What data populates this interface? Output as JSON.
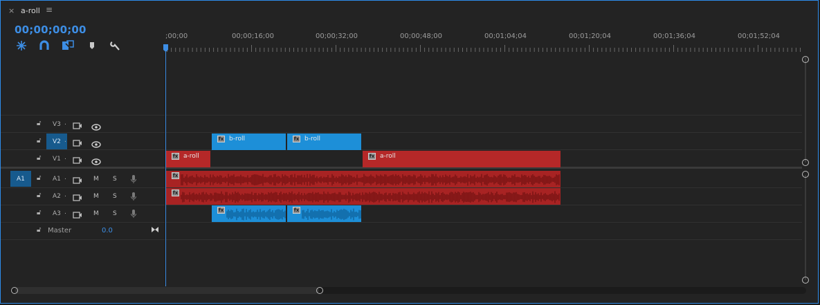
{
  "tab": {
    "title": "a-roll",
    "close_icon": "close-icon",
    "menu_icon": "hamburger-menu-icon"
  },
  "timecode": "00;00;00;00",
  "tools": [
    {
      "name": "insert-nested-sequence-tool",
      "icon": "nest-icon"
    },
    {
      "name": "snap-tool",
      "icon": "magnet-icon"
    },
    {
      "name": "linked-selection-tool",
      "icon": "linked-selection-icon"
    },
    {
      "name": "add-marker-tool",
      "icon": "marker-icon"
    },
    {
      "name": "timeline-settings-tool",
      "icon": "wrench-icon"
    }
  ],
  "ruler": {
    "labels": [
      ";00;00",
      "00;00;16;00",
      "00;00;32;00",
      "00;00;48;00",
      "00;01;04;04",
      "00;01;20;04",
      "00;01;36;04",
      "00;01;52;04"
    ]
  },
  "tracks": {
    "video": [
      {
        "id": "V3",
        "label": "V3",
        "selected": false
      },
      {
        "id": "V2",
        "label": "V2",
        "selected": true
      },
      {
        "id": "V1",
        "label": "V1",
        "selected": false
      }
    ],
    "audio": [
      {
        "id": "A1",
        "label": "A1",
        "source_patch": "A1",
        "mute": "M",
        "solo": "S"
      },
      {
        "id": "A2",
        "label": "A2",
        "mute": "M",
        "solo": "S"
      },
      {
        "id": "A3",
        "label": "A3",
        "mute": "M",
        "solo": "S"
      }
    ],
    "master": {
      "label": "Master",
      "value": "0.0"
    }
  },
  "clips": {
    "video": [
      {
        "track": "V2",
        "label": "b-roll",
        "color": "#1d8fd8"
      },
      {
        "track": "V2",
        "label": "b-roll",
        "color": "#1d8fd8"
      },
      {
        "track": "V1",
        "label": "a-roll",
        "color": "#b52828"
      },
      {
        "track": "V1",
        "label": "a-roll",
        "color": "#b52828"
      }
    ],
    "audio_colors": {
      "a_roll": "#a82323",
      "b_roll": "#1d8fd8"
    }
  },
  "colors": {
    "accent": "#3d8ee5",
    "background": "#232323",
    "selected_track": "#175a8d"
  }
}
